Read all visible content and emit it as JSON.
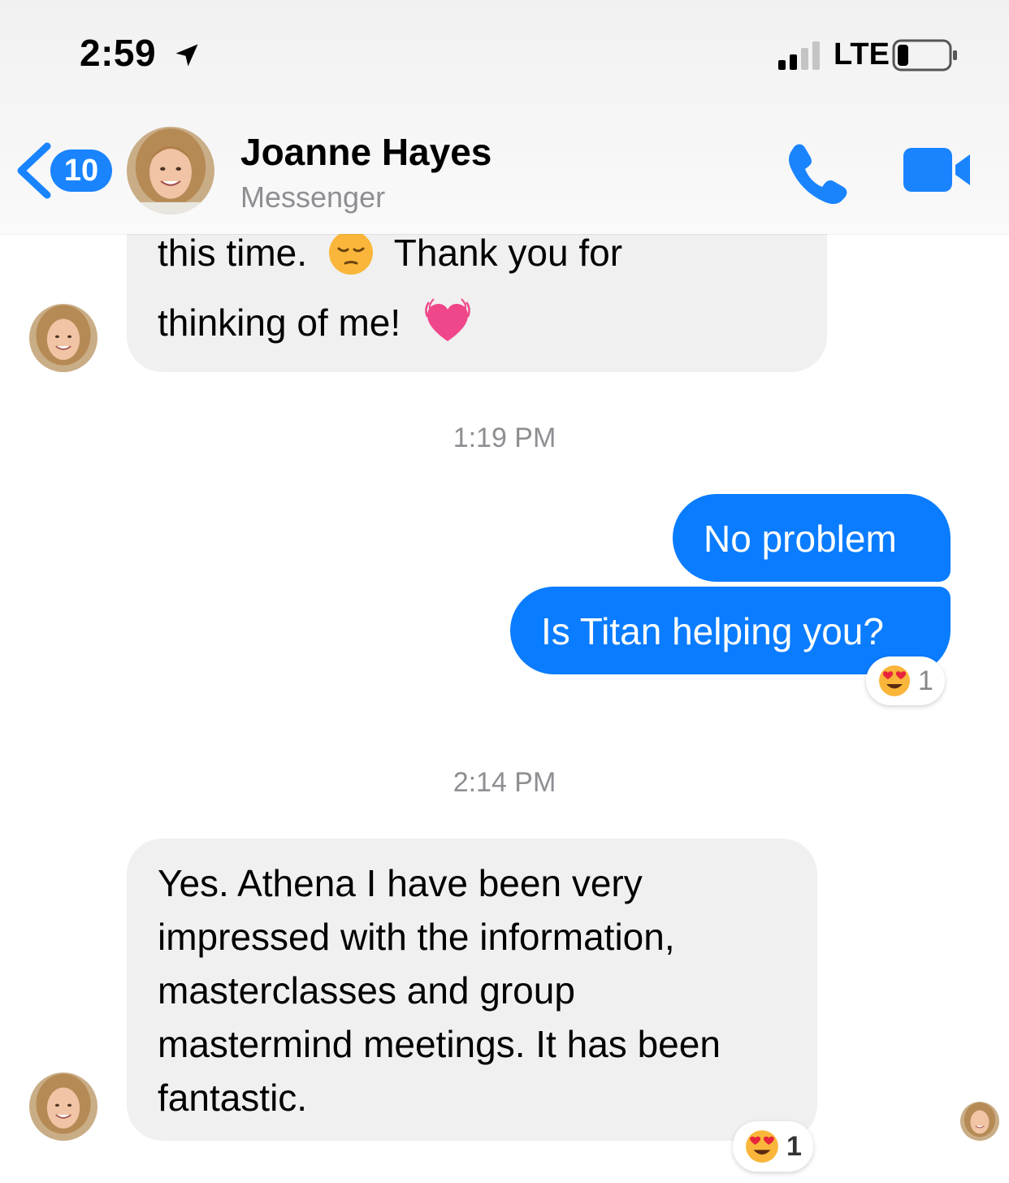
{
  "status_bar": {
    "time": "2:59",
    "network": "LTE"
  },
  "header": {
    "back_count": "10",
    "contact_name": "Joanne Hayes",
    "subtitle": "Messenger"
  },
  "messages": [
    {
      "from": "contact",
      "lines": [
        "this time.",
        "Thank you for",
        "thinking of me!"
      ]
    },
    {
      "timestamp": "1:19 PM"
    },
    {
      "from": "me",
      "text": "No problem"
    },
    {
      "from": "me",
      "text": "Is Titan helping you?",
      "reaction_count": "1"
    },
    {
      "timestamp": "2:14 PM"
    },
    {
      "from": "contact",
      "lines": [
        "Yes. Athena I have been very",
        "impressed with the information,",
        "masterclasses and group",
        "mastermind meetings. It has been",
        "fantastic."
      ],
      "reaction_count": "1"
    }
  ],
  "colors": {
    "accent": "#0a7cff",
    "incoming_bubble": "#f0f0f0"
  },
  "icons": [
    "location-arrow-icon",
    "signal-icon",
    "battery-icon",
    "back-chevron-icon",
    "phone-icon",
    "video-camera-icon",
    "pensive-face-emoji",
    "growing-heart-emoji",
    "heart-eyes-emoji"
  ]
}
